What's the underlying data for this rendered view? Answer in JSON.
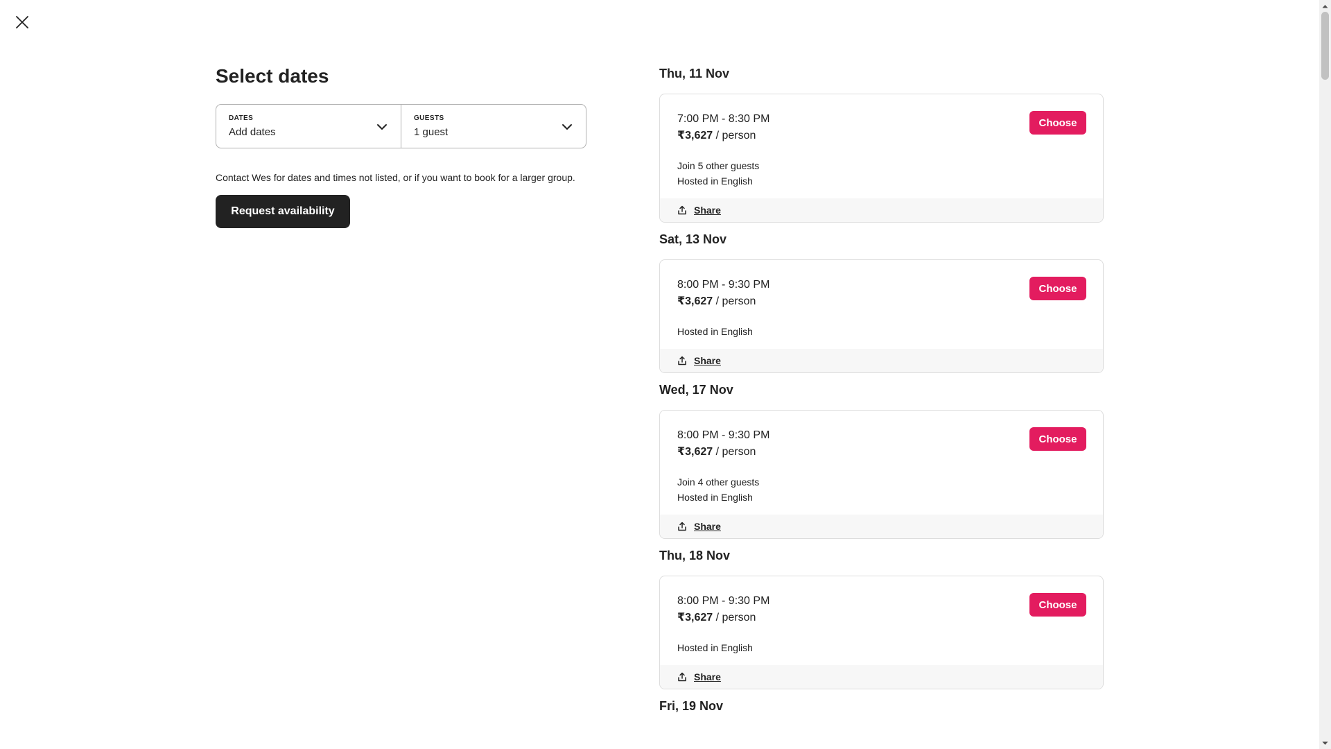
{
  "close_icon": "close-icon",
  "left": {
    "title": "Select dates",
    "dates": {
      "label": "DATES",
      "value": "Add dates",
      "icon": "chevron-down-icon"
    },
    "guests": {
      "label": "GUESTS",
      "value": "1 guest",
      "icon": "chevron-down-icon"
    },
    "note": "Contact Wes for dates and times not listed, or if you want to book for a larger group.",
    "request_button": "Request availability"
  },
  "slots": [
    {
      "date": "Thu, 11 Nov",
      "time": "7:00 PM - 8:30 PM",
      "price": "₹3,627",
      "per": " / person",
      "details": [
        "Join 5 other guests",
        "Hosted in English"
      ],
      "choose": "Choose",
      "share": "Share"
    },
    {
      "date": "Sat, 13 Nov",
      "time": "8:00 PM - 9:30 PM",
      "price": "₹3,627",
      "per": " / person",
      "details": [
        "Hosted in English"
      ],
      "choose": "Choose",
      "share": "Share"
    },
    {
      "date": "Wed, 17 Nov",
      "time": "8:00 PM - 9:30 PM",
      "price": "₹3,627",
      "per": " / person",
      "details": [
        "Join 4 other guests",
        "Hosted in English"
      ],
      "choose": "Choose",
      "share": "Share"
    },
    {
      "date": "Thu, 18 Nov",
      "time": "8:00 PM - 9:30 PM",
      "price": "₹3,627",
      "per": " / person",
      "details": [
        "Hosted in English"
      ],
      "choose": "Choose",
      "share": "Share"
    }
  ],
  "next_date": "Fri, 19 Nov",
  "colors": {
    "accent": "#e31c5f",
    "dark_button": "#222222",
    "footer_bg": "#f7f7f7"
  }
}
